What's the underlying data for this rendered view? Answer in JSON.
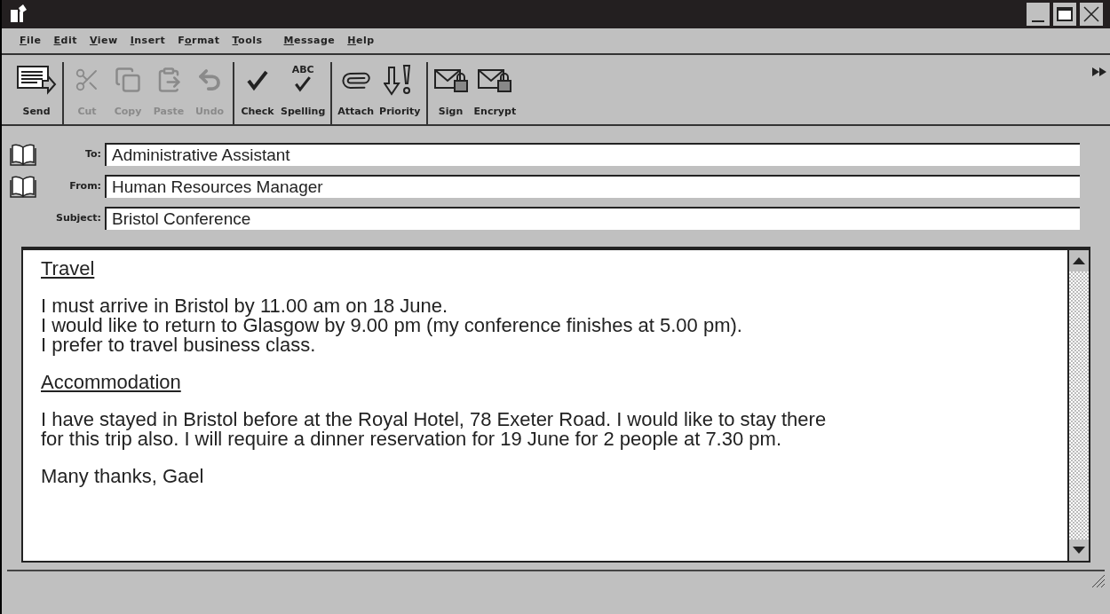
{
  "menu": [
    {
      "key": "F",
      "post": "ile"
    },
    {
      "key": "E",
      "post": "dit"
    },
    {
      "key": "V",
      "post": "iew"
    },
    {
      "key": "I",
      "post": "nsert"
    },
    {
      "pre": "F",
      "key": "o",
      "post": "rmat"
    },
    {
      "key": "T",
      "post": "ools"
    },
    {
      "key": "M",
      "post": "essage"
    },
    {
      "key": "H",
      "post": "elp"
    }
  ],
  "toolbar": [
    [
      {
        "kind": "send",
        "label": "Send",
        "disabled": false
      }
    ],
    [
      {
        "kind": "cut",
        "label": "Cut",
        "disabled": true
      },
      {
        "kind": "copy",
        "label": "Copy",
        "disabled": true
      },
      {
        "kind": "paste",
        "label": "Paste",
        "disabled": true
      },
      {
        "kind": "undo",
        "label": "Undo",
        "disabled": true
      }
    ],
    [
      {
        "kind": "check",
        "label": "Check",
        "disabled": false
      },
      {
        "kind": "spelling",
        "label": "Spelling",
        "icon_text": "ABC",
        "disabled": false
      }
    ],
    [
      {
        "kind": "attach",
        "label": "Attach",
        "disabled": false
      },
      {
        "kind": "priority",
        "label": "Priority",
        "disabled": false
      }
    ],
    [
      {
        "kind": "sign",
        "label": "Sign",
        "disabled": false
      },
      {
        "kind": "encrypt",
        "label": "Encrypt",
        "disabled": false
      }
    ]
  ],
  "fields": [
    {
      "label": "To:",
      "value": "Administrative Assistant",
      "address_book": true
    },
    {
      "label": "From:",
      "value": "Human Resources Manager",
      "address_book": true
    },
    {
      "label": "Subject:",
      "value": "Bristol Conference",
      "address_book": false
    }
  ],
  "body": [
    {
      "kind": "heading",
      "lines": [
        "Travel"
      ]
    },
    {
      "kind": "paragraph",
      "lines": [
        "I must arrive in Bristol by 11.00 am on 18 June.",
        "I would like to return to Glasgow by 9.00 pm (my conference finishes at 5.00 pm).",
        "I prefer to travel business class."
      ]
    },
    {
      "kind": "heading",
      "lines": [
        "Accommodation"
      ]
    },
    {
      "kind": "paragraph",
      "lines": [
        "I have stayed in Bristol before at the Royal Hotel, 78 Exeter Road. I would like to stay there",
        "for this trip also. I will require a dinner reservation for 19 June for 2 people at 7.30 pm."
      ]
    },
    {
      "kind": "paragraph",
      "lines": [
        "Many thanks, Gael"
      ]
    }
  ]
}
